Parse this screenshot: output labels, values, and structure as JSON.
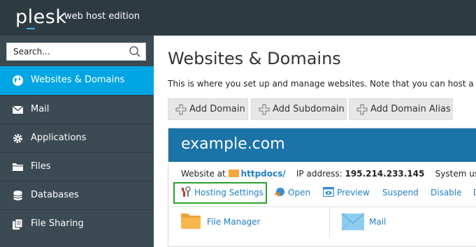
{
  "header": {
    "logo": "plesk",
    "edition": "web host edition"
  },
  "sidebar": {
    "search_placeholder": "Search...",
    "items": [
      {
        "label": "Websites & Domains",
        "icon": "globe-icon",
        "active": true
      },
      {
        "label": "Mail",
        "icon": "mail-icon"
      },
      {
        "label": "Applications",
        "icon": "gear-icon"
      },
      {
        "label": "Files",
        "icon": "files-icon"
      },
      {
        "label": "Databases",
        "icon": "database-icon"
      },
      {
        "label": "File Sharing",
        "icon": "file-sharing-icon"
      }
    ]
  },
  "main": {
    "title": "Websites & Domains",
    "description": "This is where you set up and manage websites. Note that you can host a n",
    "buttons": [
      {
        "label": "Add Domain"
      },
      {
        "label": "Add Subdomain"
      },
      {
        "label": "Add Domain Alias"
      }
    ],
    "domain": {
      "name": "example.com",
      "website_at_label": "Website at",
      "docroot": "httpdocs/",
      "ip_label": "IP address:",
      "ip": "195.214.233.145",
      "system_user_label": "System user",
      "actions": [
        "Hosting Settings",
        "Open",
        "Preview",
        "Suspend",
        "Disable",
        "D"
      ],
      "tiles": [
        {
          "label": "File Manager",
          "icon": "folder-icon"
        },
        {
          "label": "Mail",
          "icon": "envelope-icon"
        }
      ]
    }
  },
  "colors": {
    "topbar": "#2d3a42",
    "sidebar": "#3b4a53",
    "active": "#00a6e4",
    "domain_header": "#1c73a7",
    "link": "#1e7ec8",
    "highlight": "#2aa02a"
  }
}
